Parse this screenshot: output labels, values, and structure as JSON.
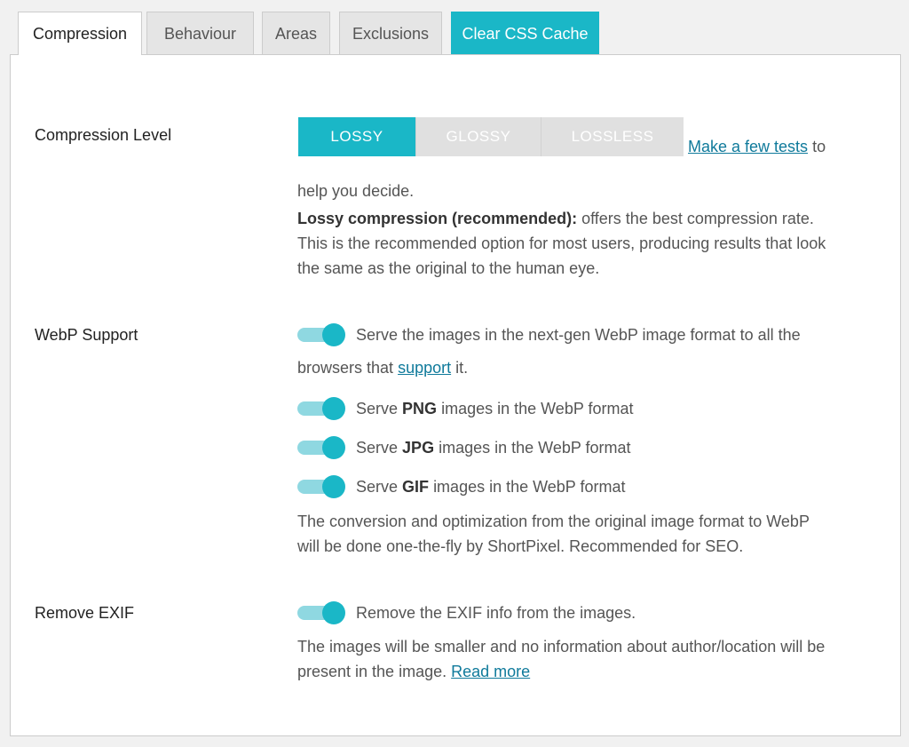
{
  "tabs": [
    {
      "label": "Compression"
    },
    {
      "label": "Behaviour"
    },
    {
      "label": "Areas"
    },
    {
      "label": "Exclusions"
    },
    {
      "label": "Clear CSS Cache"
    }
  ],
  "compression": {
    "label": "Compression Level",
    "options": [
      "LOSSY",
      "GLOSSY",
      "LOSSLESS"
    ],
    "selected": "LOSSY",
    "tests_link": "Make a few tests",
    "tests_suffix": "to",
    "help_line": "help you decide.",
    "desc_bold": "Lossy compression (recommended):",
    "desc_rest": "offers the best compression rate.",
    "desc_line2": "This is the recommended option for most users, producing results that look",
    "desc_line3": "the same as the original to the human eye."
  },
  "webp": {
    "label": "WebP Support",
    "main_text": "Serve the images in the next-gen WebP image format to all the",
    "main_text2_pre": "browsers that",
    "main_link": "support",
    "main_text2_post": "it.",
    "png_pre": "Serve",
    "png_bold": "PNG",
    "png_post": "images in the WebP format",
    "jpg_pre": "Serve",
    "jpg_bold": "JPG",
    "jpg_post": "images in the WebP format",
    "gif_pre": "Serve",
    "gif_bold": "GIF",
    "gif_post": "images in the WebP format",
    "note_line1": "The conversion and optimization from the original image format to WebP",
    "note_line2": "will be done one-the-fly by ShortPixel. Recommended for SEO."
  },
  "exif": {
    "label": "Remove EXIF",
    "toggle_text": "Remove the EXIF info from the images.",
    "note_line1": "The images will be smaller and no information about author/location will be",
    "note_line2": "present in the image.",
    "read_more": "Read more"
  },
  "colors": {
    "accent": "#1ab7c7",
    "accent_light": "#8fd8e1",
    "link": "#0f7a9b"
  }
}
